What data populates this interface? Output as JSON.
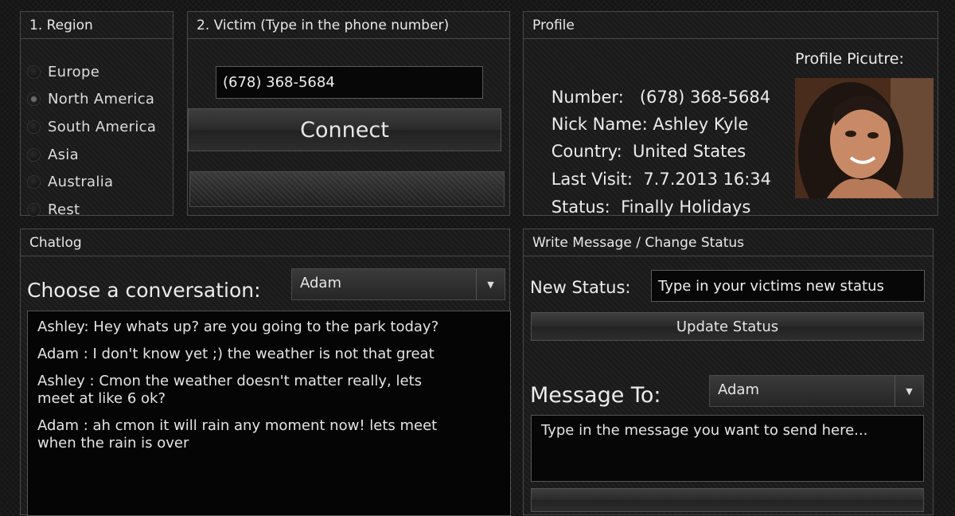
{
  "region": {
    "title": "1. Region",
    "options": [
      "Europe",
      "North America",
      "South America",
      "Asia",
      "Australia",
      "Rest"
    ],
    "selected": "North America"
  },
  "victim": {
    "title": "2. Victim (Type in the phone number)",
    "phone": "(678) 368-5684",
    "connect_label": "Connect"
  },
  "profile": {
    "title": "Profile",
    "picture_label": "Profile Picutre:",
    "number_label": "Number:",
    "number": "(678) 368-5684",
    "nick_label": "Nick Name:",
    "nick": "Ashley Kyle",
    "country_label": "Country:",
    "country": "United States",
    "last_visit_label": "Last Visit:",
    "last_visit": "7.7.2013 16:34",
    "status_label": "Status:",
    "status": "Finally Holidays"
  },
  "chatlog": {
    "title": "Chatlog",
    "choose_label": "Choose a conversation:",
    "selected_conversation": "Adam",
    "messages": [
      "Ashley: Hey whats up? are you going to the park today?",
      "Adam : I don't know yet ;) the weather is not that great",
      "Ashley : Cmon the weather doesn't matter really, lets\nmeet at like 6 ok?",
      "Adam : ah cmon it will rain any moment now! lets meet\nwhen the rain is over"
    ]
  },
  "write": {
    "title": "Write Message / Change Status",
    "new_status_label": "New Status:",
    "new_status_value": "Type in your victims new status",
    "update_label": "Update Status",
    "message_to_label": "Message To:",
    "message_to_value": "Adam",
    "message_value": "Type in the message you want to send here..."
  },
  "colors": {
    "background": "#141414",
    "panel_border": "#4a4a4a",
    "text": "#e6e6e6"
  }
}
